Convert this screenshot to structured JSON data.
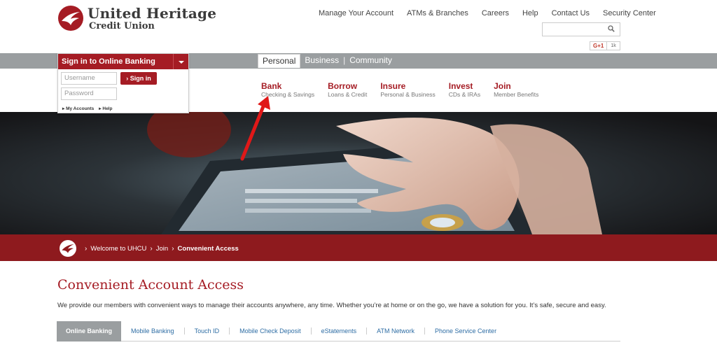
{
  "brand": {
    "name_line1": "United Heritage",
    "name_line2": "Credit Union",
    "color": "#a51c24"
  },
  "topnav": [
    "Manage Your Account",
    "ATMs & Branches",
    "Careers",
    "Help",
    "Contact Us",
    "Security Center"
  ],
  "search": {
    "placeholder": "",
    "icon": "search-icon"
  },
  "social": {
    "gplus": "G+1",
    "count": "1k"
  },
  "segments": {
    "items": [
      "Personal",
      "Business",
      "Community"
    ],
    "active": "Personal"
  },
  "mainnav": [
    {
      "title": "Bank",
      "sub": "Checking & Savings"
    },
    {
      "title": "Borrow",
      "sub": "Loans & Credit"
    },
    {
      "title": "Insure",
      "sub": "Personal & Business"
    },
    {
      "title": "Invest",
      "sub": "CDs & IRAs"
    },
    {
      "title": "Join",
      "sub": "Member Benefits"
    }
  ],
  "signin": {
    "title": "Sign in to Online Banking",
    "username_placeholder": "Username",
    "password_placeholder": "Password",
    "button": "Sign in",
    "links": [
      "My Accounts",
      "Help"
    ]
  },
  "breadcrumb": [
    "Welcome to UHCU",
    "Join",
    "Convenient Access"
  ],
  "page": {
    "title": "Convenient Account Access",
    "intro": "We provide our members with convenient ways to manage their accounts anywhere, any time. Whether you’re at home or on the go, we have a solution for you. It’s safe, secure and easy."
  },
  "tabs": {
    "items": [
      "Online Banking",
      "Mobile Banking",
      "Touch ID",
      "Mobile Check Deposit",
      "eStatements",
      "ATM Network",
      "Phone Service Center"
    ],
    "active": "Online Banking"
  }
}
